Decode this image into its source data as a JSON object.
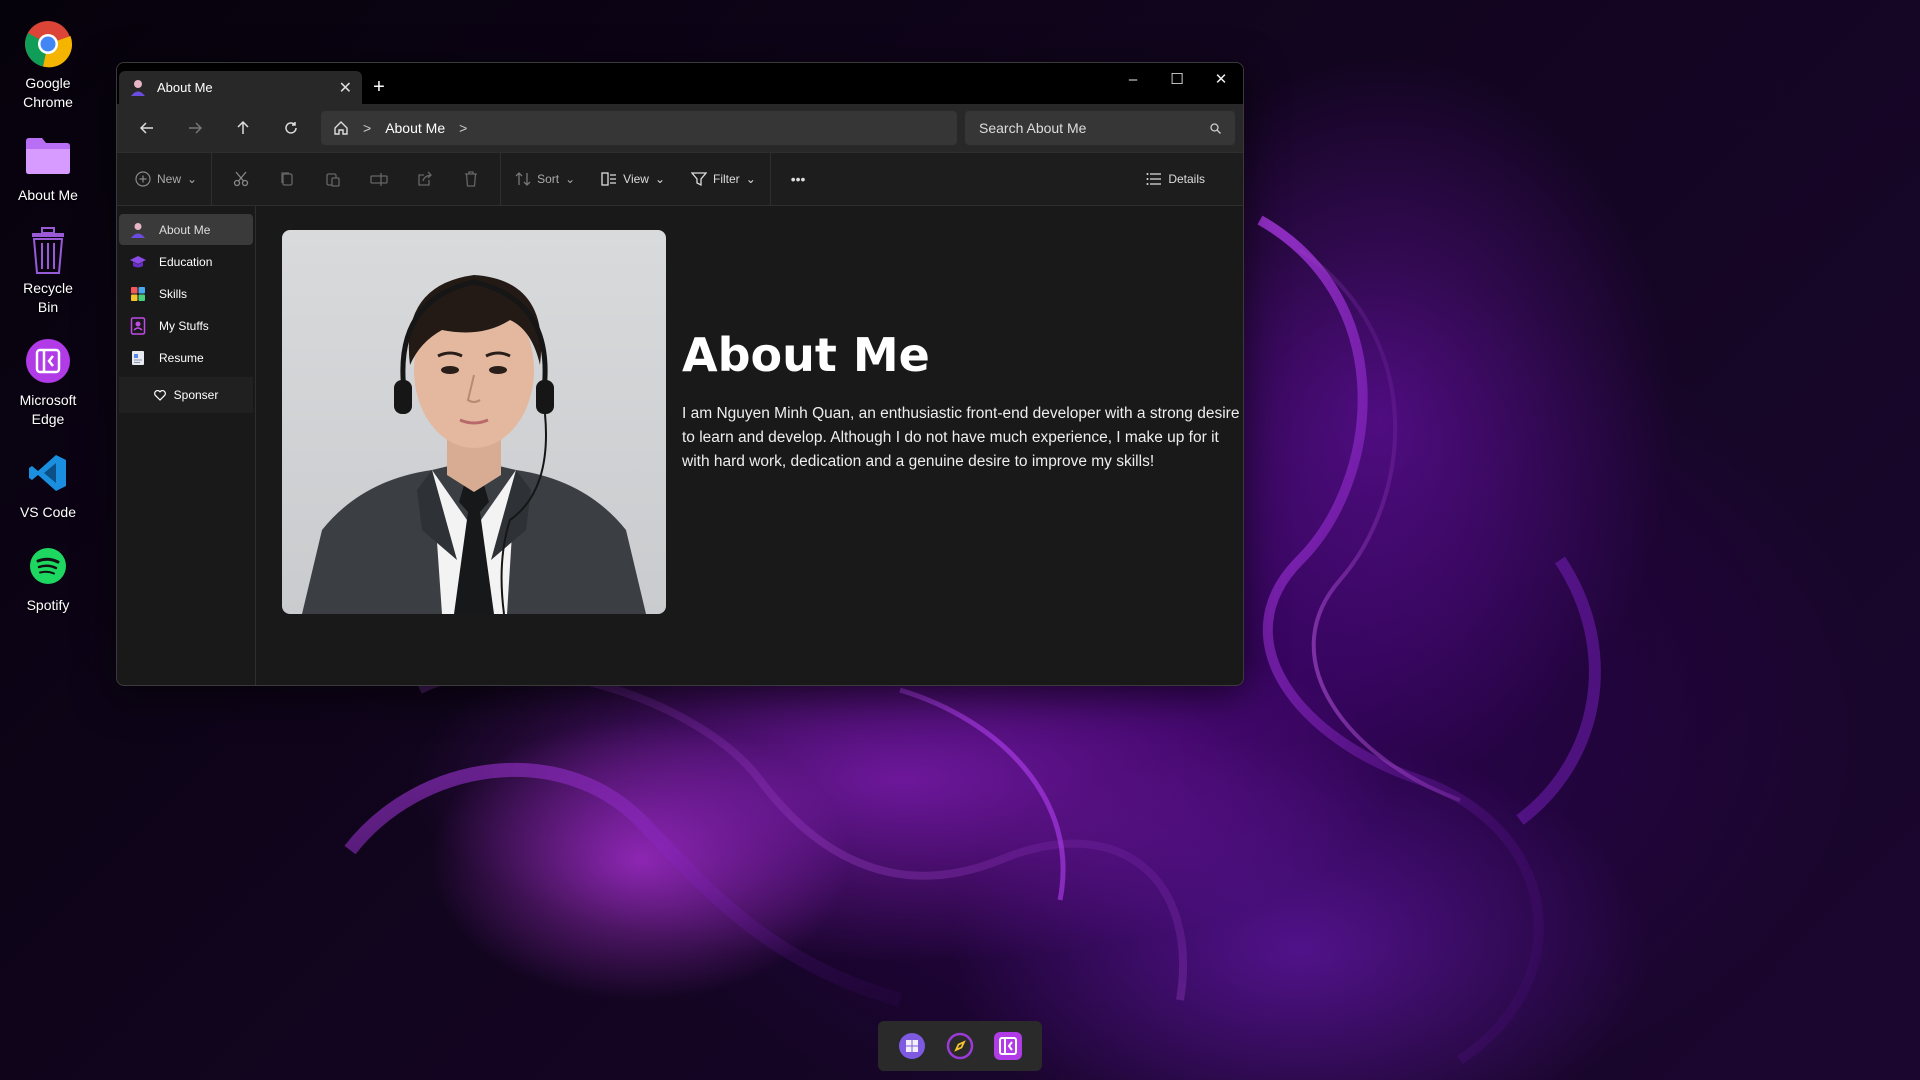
{
  "desktop": {
    "icons": [
      {
        "label": "Google Chrome",
        "icon": "chrome-icon"
      },
      {
        "label": "About Me",
        "icon": "folder-icon"
      },
      {
        "label": "Recycle Bin",
        "icon": "recycle-bin-icon"
      },
      {
        "label": "Microsoft Edge",
        "icon": "edge-icon"
      },
      {
        "label": "VS Code",
        "icon": "vscode-icon"
      },
      {
        "label": "Spotify",
        "icon": "spotify-icon"
      }
    ]
  },
  "window": {
    "tab_title": "About Me",
    "new_tab": "+",
    "close_tab": "✕",
    "controls": {
      "minimize": "–",
      "maximize": "☐",
      "close": "✕"
    },
    "address": {
      "crumb": "About Me"
    },
    "search_placeholder": "Search About Me"
  },
  "toolbar": {
    "new": "New",
    "sort": "Sort",
    "view": "View",
    "filter": "Filter",
    "more": "•••",
    "details": "Details"
  },
  "sidebar": {
    "items": [
      {
        "label": "About Me",
        "active": true,
        "icon": "person-icon"
      },
      {
        "label": "Education",
        "active": false,
        "icon": "graduation-cap-icon"
      },
      {
        "label": "Skills",
        "active": false,
        "icon": "grid-icon"
      },
      {
        "label": "My Stuffs",
        "active": false,
        "icon": "contact-icon"
      },
      {
        "label": "Resume",
        "active": false,
        "icon": "document-icon"
      }
    ],
    "sponsor": "Sponser"
  },
  "content": {
    "title": "About Me",
    "text": "I am Nguyen Minh Quan, an enthusiastic front-end developer with a strong desire to learn and develop. Although I do not have much experience, I make up for it with hard work, dedication and a genuine desire to improve my skills!"
  },
  "taskbar": {
    "apps": [
      "start-icon",
      "compass-icon",
      "edge-icon"
    ]
  },
  "colors": {
    "accent": "#a53cf0",
    "window_bg": "#191919",
    "titlebar_bg": "#000000"
  }
}
